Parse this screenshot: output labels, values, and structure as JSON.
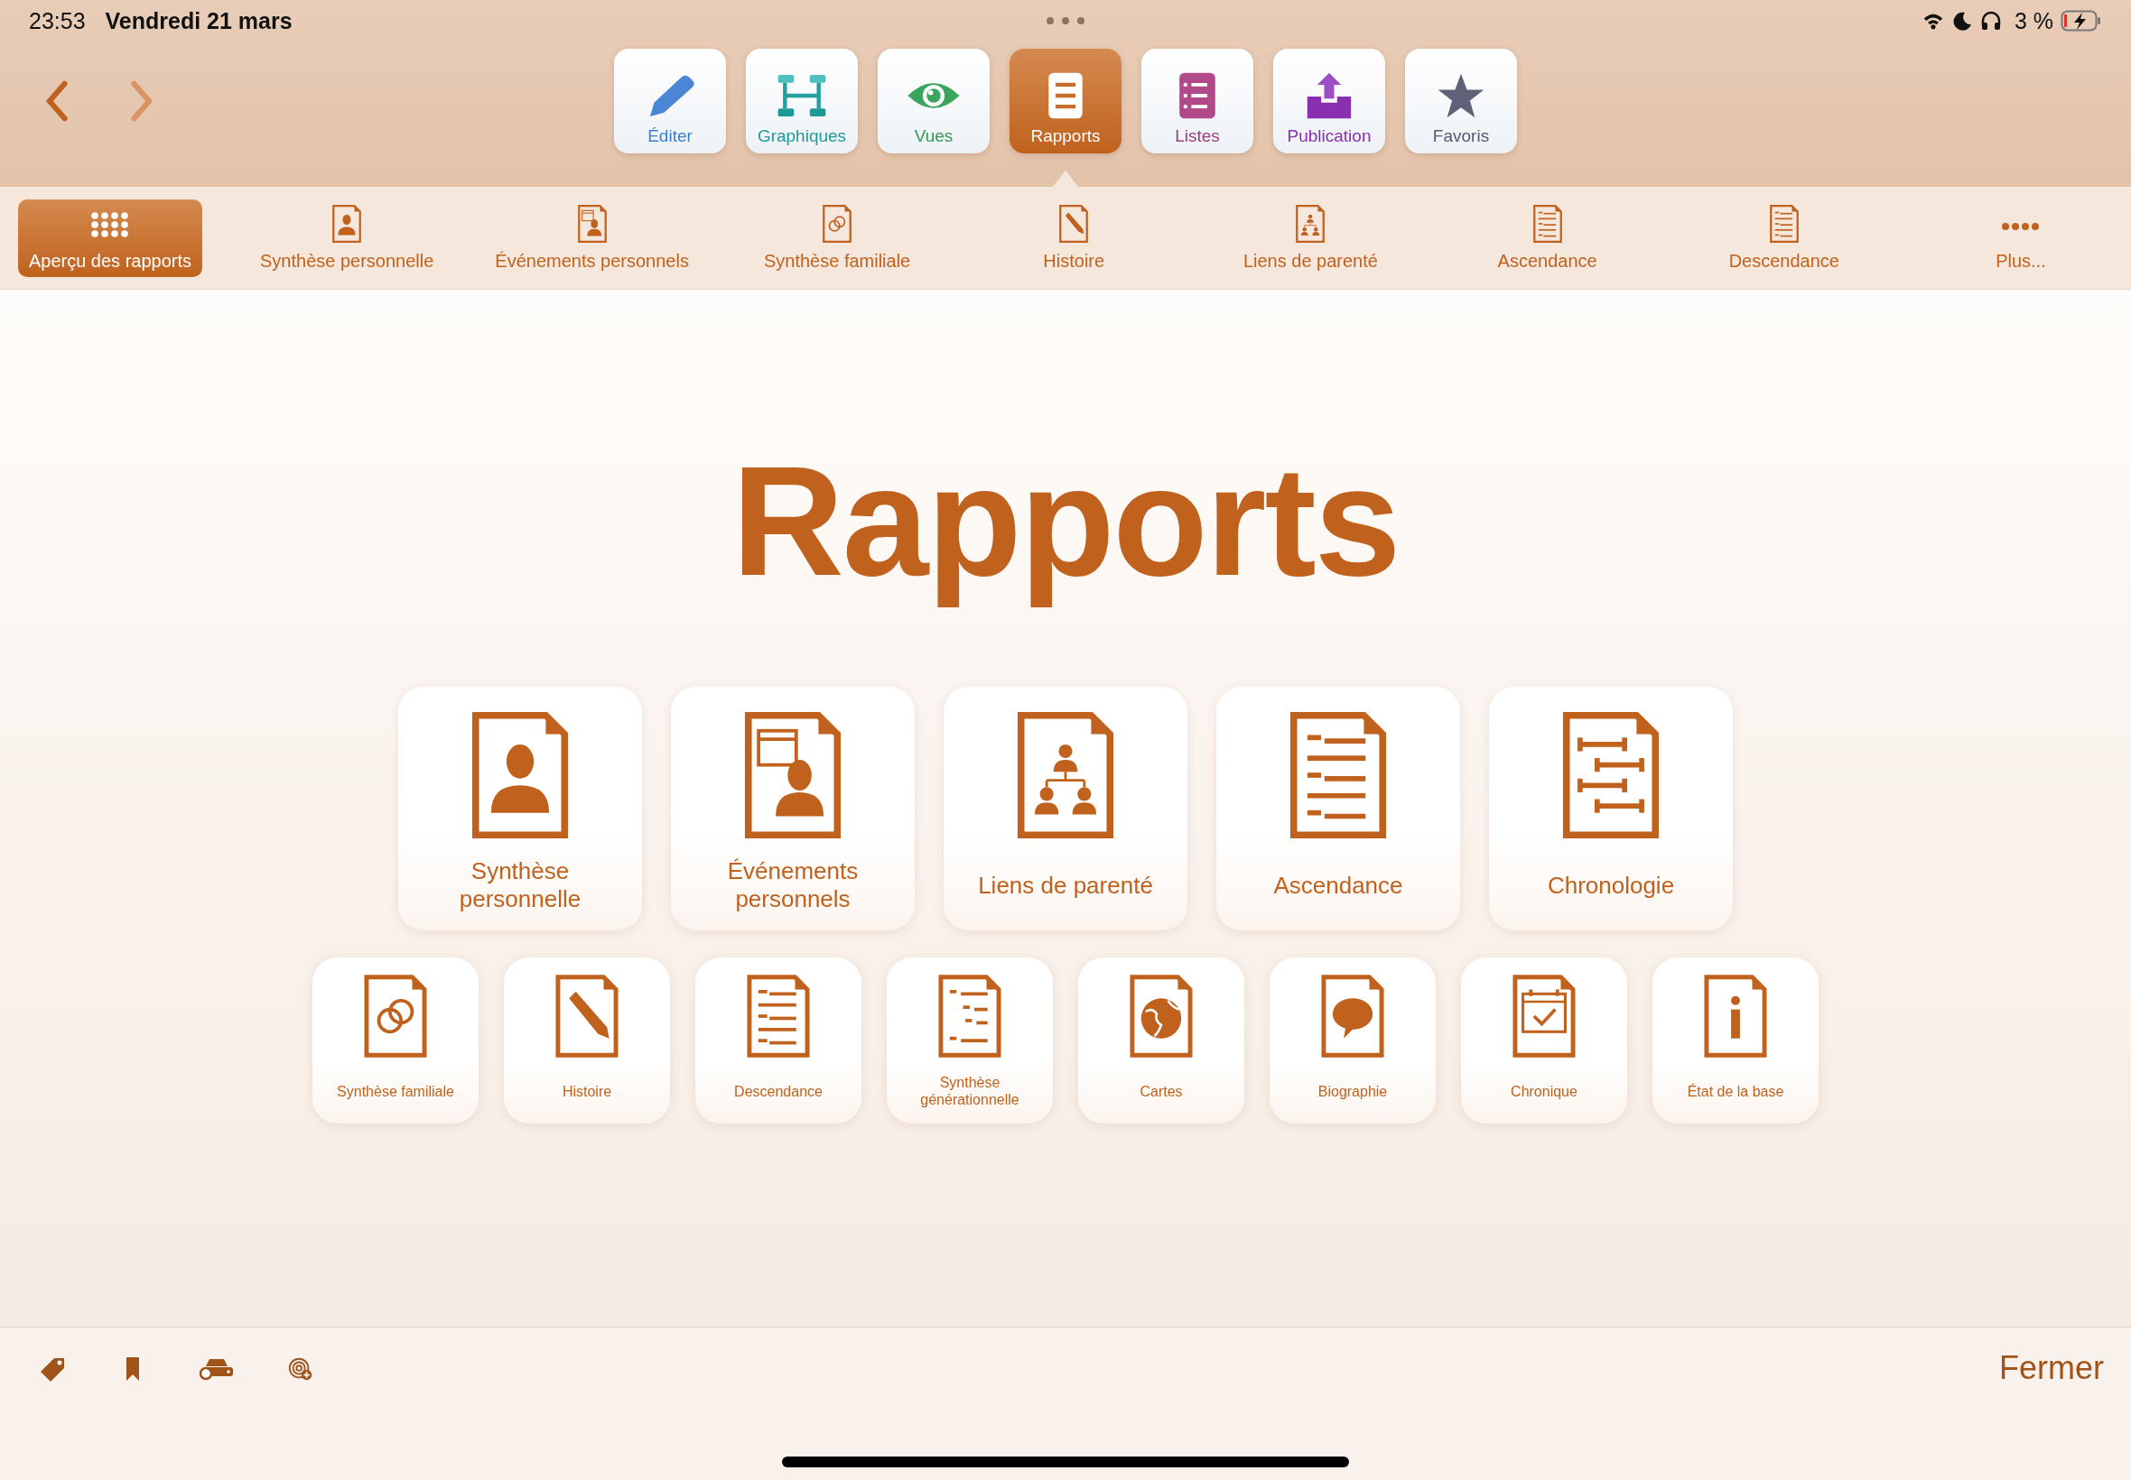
{
  "status_bar": {
    "time": "23:53",
    "date": "Vendredi 21 mars",
    "battery": "3 %"
  },
  "toolbar": {
    "tabs": [
      {
        "label": "Éditer",
        "kind": "edit",
        "selected": false
      },
      {
        "label": "Graphiques",
        "kind": "charts",
        "selected": false
      },
      {
        "label": "Vues",
        "kind": "views",
        "selected": false
      },
      {
        "label": "Rapports",
        "kind": "reports",
        "selected": true
      },
      {
        "label": "Listes",
        "kind": "lists",
        "selected": false
      },
      {
        "label": "Publication",
        "kind": "publish",
        "selected": false
      },
      {
        "label": "Favoris",
        "kind": "favorites",
        "selected": false
      }
    ]
  },
  "report_bar": {
    "items": [
      {
        "label": "Aperçu des rapports",
        "kind": "grid",
        "selected": true
      },
      {
        "label": "Synthèse personnelle",
        "kind": "person",
        "selected": false
      },
      {
        "label": "Événements personnels",
        "kind": "events",
        "selected": false
      },
      {
        "label": "Synthèse familiale",
        "kind": "family",
        "selected": false
      },
      {
        "label": "Histoire",
        "kind": "story",
        "selected": false
      },
      {
        "label": "Liens de parenté",
        "kind": "kinship",
        "selected": false
      },
      {
        "label": "Ascendance",
        "kind": "ascendance",
        "selected": false
      },
      {
        "label": "Descendance",
        "kind": "descendance",
        "selected": false
      },
      {
        "label": "Plus...",
        "kind": "more",
        "selected": false
      }
    ]
  },
  "title": "Rapports",
  "primary_reports": [
    {
      "label": "Synthèse personnelle",
      "kind": "person"
    },
    {
      "label": "Événements personnels",
      "kind": "events"
    },
    {
      "label": "Liens de parenté",
      "kind": "kinship"
    },
    {
      "label": "Ascendance",
      "kind": "ascendance"
    },
    {
      "label": "Chronologie",
      "kind": "chronology"
    }
  ],
  "secondary_reports": [
    {
      "label": "Synthèse familiale",
      "kind": "family"
    },
    {
      "label": "Histoire",
      "kind": "story"
    },
    {
      "label": "Descendance",
      "kind": "descendance"
    },
    {
      "label": "Synthèse générationnelle",
      "kind": "generational"
    },
    {
      "label": "Cartes",
      "kind": "maps"
    },
    {
      "label": "Biographie",
      "kind": "biography"
    },
    {
      "label": "Chronique",
      "kind": "chronicle"
    },
    {
      "label": "État de la base",
      "kind": "info"
    }
  ],
  "bottom_bar": {
    "close": "Fermer"
  }
}
